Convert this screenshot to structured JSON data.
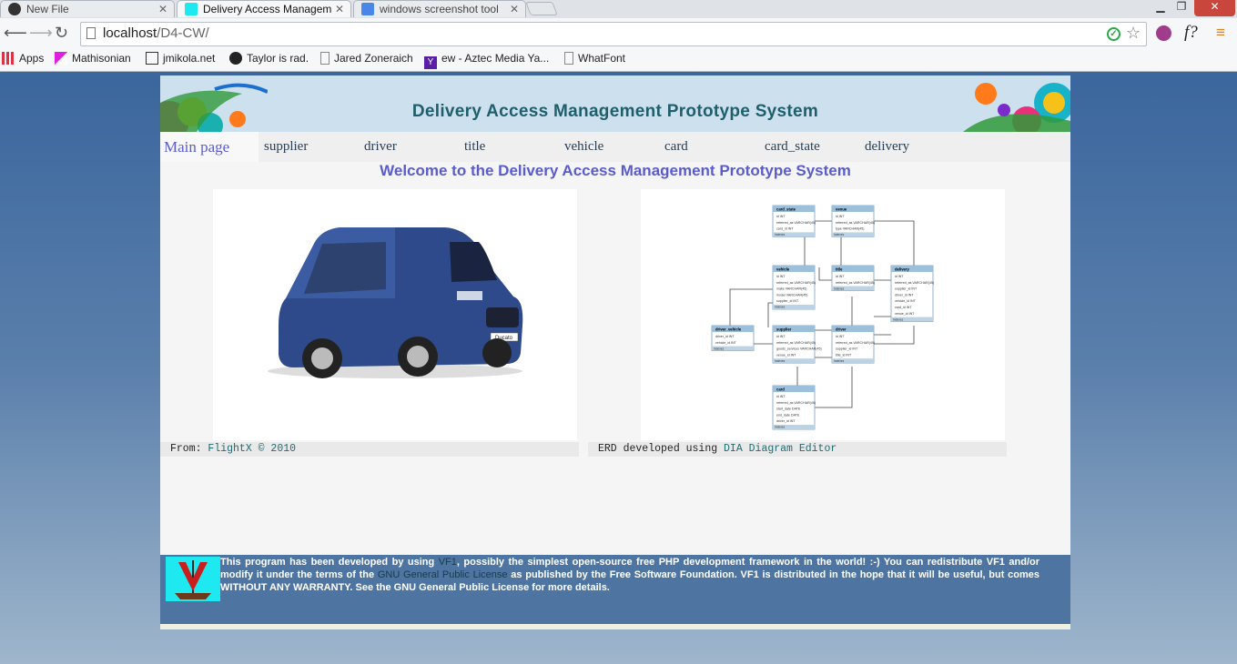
{
  "browser": {
    "tabs": [
      {
        "title": "New File",
        "icon": "github-icon"
      },
      {
        "title": "Delivery Access Managem",
        "icon": "vf1-icon"
      },
      {
        "title": "windows screenshot tool",
        "icon": "google-icon"
      }
    ],
    "url_host": "localhost",
    "url_path": "/D4-CW/",
    "bookmarks": [
      {
        "label": "Apps",
        "icon": "apps-grid-icon"
      },
      {
        "label": "Mathisonian",
        "icon": "bookmark-icon"
      },
      {
        "label": "jmikola.net",
        "icon": "bookmark-icon"
      },
      {
        "label": "Taylor is rad.",
        "icon": "bookmark-icon"
      },
      {
        "label": "Jared Zoneraich",
        "icon": "page-icon"
      },
      {
        "label": "ew - Aztec Media Ya...",
        "icon": "yahoo-icon"
      },
      {
        "label": "WhatFont",
        "icon": "page-icon"
      }
    ]
  },
  "site": {
    "title": "Delivery Access Management Prototype System",
    "nav": [
      "Main page",
      "supplier",
      "driver",
      "title",
      "vehicle",
      "card",
      "card_state",
      "delivery"
    ],
    "welcome": "Welcome to the Delivery Access Management Prototype System",
    "left_caption_prefix": "From: ",
    "left_caption_link": "FlightX © 2010",
    "right_caption_prefix": "ERD developed using ",
    "right_caption_link": "DIA Diagram Editor",
    "van_plate": "Ducato",
    "erd_tables": [
      {
        "name": "card_state",
        "rows": [
          "id INT",
          "referred_as VARCHAR(45)",
          "card_id INT"
        ]
      },
      {
        "name": "venue",
        "rows": [
          "id INT",
          "referred_as VARCHAR(45)",
          "type VARCHAR(45)"
        ]
      },
      {
        "name": "vehicle",
        "rows": [
          "id INT",
          "referred_as VARCHAR(45)",
          "make VARCHAR(45)",
          "model VARCHAR(45)",
          "supplier_id INT"
        ]
      },
      {
        "name": "title",
        "rows": [
          "id INT",
          "referred_as VARCHAR(45)"
        ]
      },
      {
        "name": "delivery",
        "rows": [
          "id INT",
          "referred_as VARCHAR(45)",
          "supplier_id INT",
          "driver_id INT",
          "vehicle_id INT",
          "card_id INT",
          "venue_id INT"
        ]
      },
      {
        "name": "driver_vehicle",
        "rows": [
          "driver_id INT",
          "vehicle_id INT"
        ]
      },
      {
        "name": "supplier",
        "rows": [
          "id INT",
          "referred_as VARCHAR(45)",
          "goods_services VARCHAR(45)",
          "venue_id INT"
        ]
      },
      {
        "name": "driver",
        "rows": [
          "id INT",
          "referred_as VARCHAR(45)",
          "supplier_id INT",
          "title_id INT"
        ]
      },
      {
        "name": "card",
        "rows": [
          "id INT",
          "referred_as VARCHAR(45)",
          "start_date DATE",
          "end_date DATE",
          "driver_id INT"
        ]
      }
    ],
    "erd_index_label": "Indexes",
    "footer": {
      "t1": "This program has been developed by using ",
      "link1": "VF1",
      "t2": ", possibly the simplest open-source free PHP development framework in the world! :-) You can redistribute VF1 and/or modify it under the terms of the ",
      "link2": "GNU General Public License",
      "t3": " as published by the Free Software Foundation. VF1 is distributed in the hope that it will be useful, but comes WITHOUT ANY WARRANTY. See the GNU General Public License for more details."
    }
  }
}
